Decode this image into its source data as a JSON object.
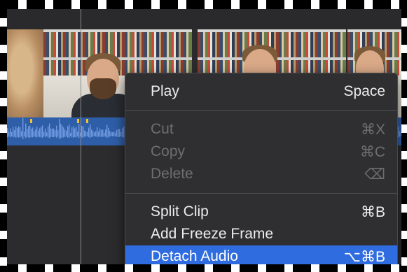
{
  "colors": {
    "menu_bg": "#2f2f31",
    "highlight": "#2f6ce0",
    "audio": "#2f5ea8",
    "disabled_text": "#6e6e70"
  },
  "context_menu": {
    "groups": [
      [
        {
          "label": "Play",
          "shortcut": "Space",
          "enabled": true
        }
      ],
      [
        {
          "label": "Cut",
          "shortcut": "⌘X",
          "enabled": false
        },
        {
          "label": "Copy",
          "shortcut": "⌘C",
          "enabled": false
        },
        {
          "label": "Delete",
          "shortcut": "⌫",
          "enabled": false
        }
      ],
      [
        {
          "label": "Split Clip",
          "shortcut": "⌘B",
          "enabled": true
        },
        {
          "label": "Add Freeze Frame",
          "shortcut": "",
          "enabled": true
        },
        {
          "label": "Detach Audio",
          "shortcut": "⌥⌘B",
          "enabled": true,
          "highlighted": true
        }
      ]
    ]
  },
  "icons": {
    "delete_shortcut": "delete-key-icon",
    "audio_markers": "marker-icon"
  }
}
